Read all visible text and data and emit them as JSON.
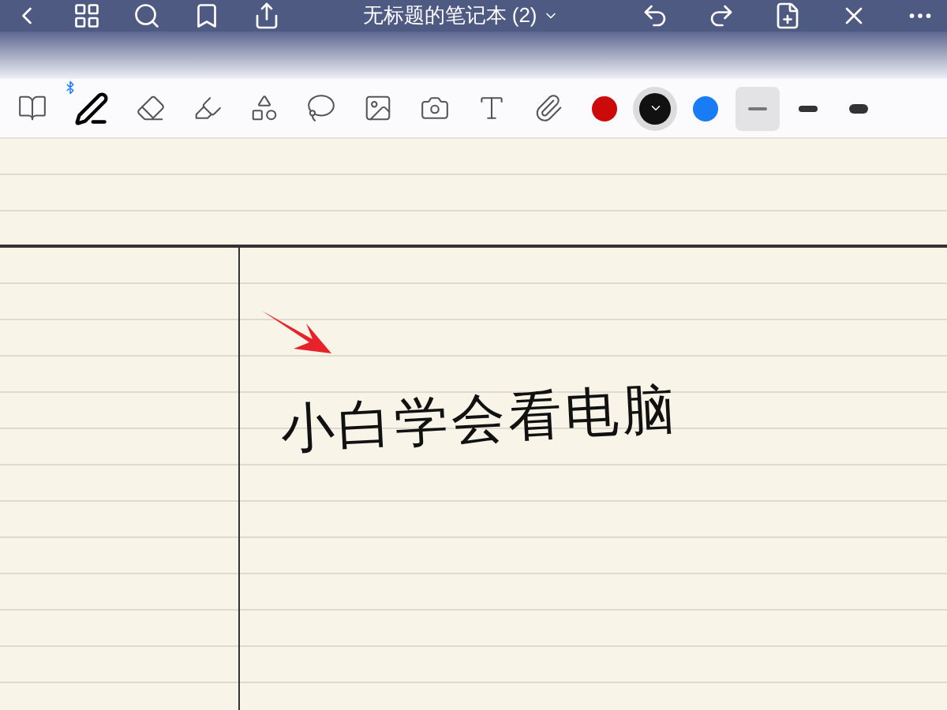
{
  "title": "无标题的笔记本 (2)",
  "tools": [
    {
      "kind": "pages",
      "selected": false
    },
    {
      "kind": "pen",
      "selected": true
    },
    {
      "kind": "eraser",
      "selected": false
    },
    {
      "kind": "highlighter",
      "selected": false
    },
    {
      "kind": "shapes",
      "selected": false
    },
    {
      "kind": "lasso",
      "selected": false
    },
    {
      "kind": "image",
      "selected": false
    },
    {
      "kind": "camera",
      "selected": false
    },
    {
      "kind": "text",
      "selected": false
    },
    {
      "kind": "clip",
      "selected": false
    }
  ],
  "colors": [
    {
      "color": "#cc0a0a",
      "selected": false
    },
    {
      "color": "#111111",
      "selected": true
    },
    {
      "color": "#1a7cf5",
      "selected": false
    }
  ],
  "widths": [
    {
      "kind": "thin",
      "selected": true
    },
    {
      "kind": "medium",
      "selected": false
    },
    {
      "kind": "thick",
      "selected": false
    }
  ],
  "handwriting": "小白学会看电脑"
}
